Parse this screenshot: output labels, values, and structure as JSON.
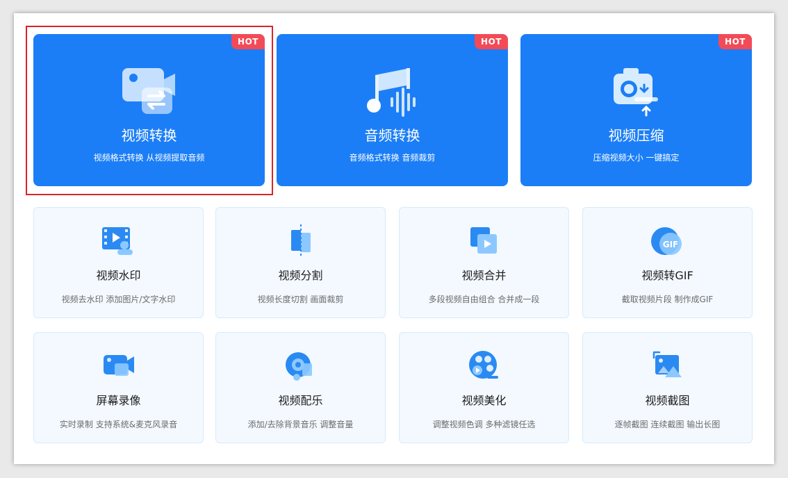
{
  "badge_label": "HOT",
  "featured": [
    {
      "title": "视频转换",
      "desc": "视频格式转换 从视频提取音频",
      "icon": "video-convert-icon"
    },
    {
      "title": "音频转换",
      "desc": "音频格式转换 音频裁剪",
      "icon": "audio-convert-icon"
    },
    {
      "title": "视频压缩",
      "desc": "压缩视频大小 一键搞定",
      "icon": "video-compress-icon"
    }
  ],
  "tools": [
    {
      "title": "视频水印",
      "desc": "视频去水印 添加图片/文字水印",
      "icon": "video-watermark-icon"
    },
    {
      "title": "视频分割",
      "desc": "视频长度切割 画面裁剪",
      "icon": "video-split-icon"
    },
    {
      "title": "视频合并",
      "desc": "多段视频自由组合 合并成一段",
      "icon": "video-merge-icon"
    },
    {
      "title": "视频转GIF",
      "desc": "截取视频片段 制作成GIF",
      "icon": "video-to-gif-icon",
      "icon_text": "GIF"
    },
    {
      "title": "屏幕录像",
      "desc": "实时录制 支持系统&麦克风录音",
      "icon": "screen-record-icon"
    },
    {
      "title": "视频配乐",
      "desc": "添加/去除背景音乐 调整音量",
      "icon": "video-music-icon"
    },
    {
      "title": "视频美化",
      "desc": "调整视频色调 多种滤镜任选",
      "icon": "video-beautify-icon"
    },
    {
      "title": "视频截图",
      "desc": "逐帧截图 连续截图 输出长图",
      "icon": "video-screenshot-icon"
    }
  ],
  "colors": {
    "featured_bg": "#1b7ef7",
    "hot_badge": "#f24b57",
    "selection_frame": "#d9232a",
    "tool_card_bg": "#f3f9ff"
  }
}
